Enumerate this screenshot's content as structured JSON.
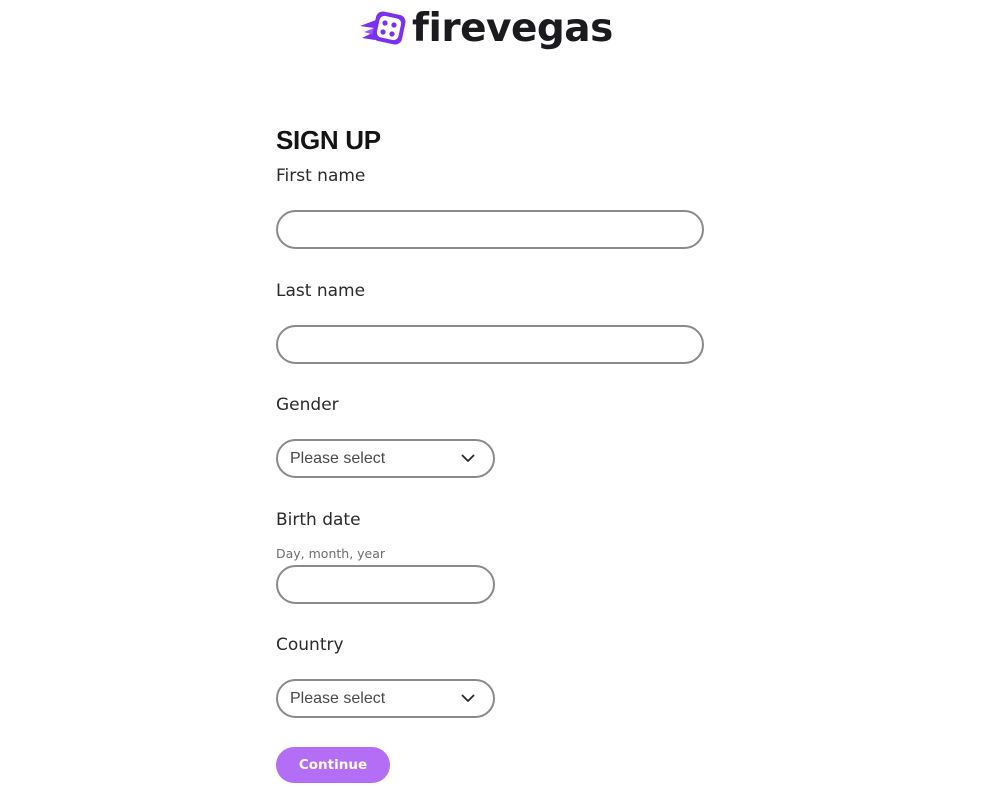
{
  "brand": {
    "name": "firevegas",
    "icon": "dice-logo-icon",
    "accent_color": "#7b2ff0"
  },
  "form": {
    "title": "SIGN UP",
    "first_name": {
      "label": "First name",
      "value": "",
      "placeholder": ""
    },
    "last_name": {
      "label": "Last name",
      "value": "",
      "placeholder": ""
    },
    "gender": {
      "label": "Gender",
      "selected": "Please select",
      "icon": "chevron-down-icon"
    },
    "birth_date": {
      "label": "Birth date",
      "hint": "Day, month, year",
      "value": "",
      "placeholder": ""
    },
    "country": {
      "label": "Country",
      "selected": "Please select",
      "icon": "chevron-down-icon"
    },
    "continue_label": "Continue",
    "button_color": "#b36ef5"
  }
}
